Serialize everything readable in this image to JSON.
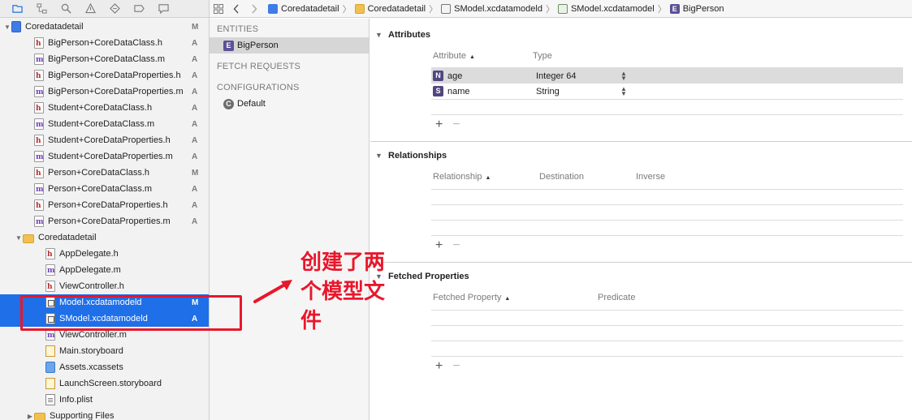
{
  "navigator": {
    "toolbar_icons": [
      "folder-icon",
      "hierarchy-icon",
      "search-icon",
      "warning-icon",
      "test-diamond-icon",
      "breakpoint-icon",
      "report-icon"
    ],
    "files": [
      {
        "name": "Coredatadetail",
        "status": "M",
        "type": "project",
        "indent": 0,
        "disclosure": "down"
      },
      {
        "name": "BigPerson+CoreDataClass.h",
        "status": "A",
        "type": "h",
        "indent": 2
      },
      {
        "name": "BigPerson+CoreDataClass.m",
        "status": "A",
        "type": "m",
        "indent": 2
      },
      {
        "name": "BigPerson+CoreDataProperties.h",
        "status": "A",
        "type": "h",
        "indent": 2
      },
      {
        "name": "BigPerson+CoreDataProperties.m",
        "status": "A",
        "type": "m",
        "indent": 2
      },
      {
        "name": "Student+CoreDataClass.h",
        "status": "A",
        "type": "h",
        "indent": 2
      },
      {
        "name": "Student+CoreDataClass.m",
        "status": "A",
        "type": "m",
        "indent": 2
      },
      {
        "name": "Student+CoreDataProperties.h",
        "status": "A",
        "type": "h",
        "indent": 2
      },
      {
        "name": "Student+CoreDataProperties.m",
        "status": "A",
        "type": "m",
        "indent": 2
      },
      {
        "name": "Person+CoreDataClass.h",
        "status": "M",
        "type": "h",
        "indent": 2
      },
      {
        "name": "Person+CoreDataClass.m",
        "status": "A",
        "type": "m",
        "indent": 2
      },
      {
        "name": "Person+CoreDataProperties.h",
        "status": "A",
        "type": "h",
        "indent": 2
      },
      {
        "name": "Person+CoreDataProperties.m",
        "status": "A",
        "type": "m",
        "indent": 2
      },
      {
        "name": "Coredatadetail",
        "status": "",
        "type": "folder",
        "indent": 1,
        "disclosure": "down"
      },
      {
        "name": "AppDelegate.h",
        "status": "",
        "type": "h",
        "indent": 3
      },
      {
        "name": "AppDelegate.m",
        "status": "",
        "type": "m",
        "indent": 3
      },
      {
        "name": "ViewController.h",
        "status": "",
        "type": "h",
        "indent": 3
      },
      {
        "name": "Model.xcdatamodeld",
        "status": "M",
        "type": "model",
        "indent": 3,
        "selected": true
      },
      {
        "name": "SModel.xcdatamodeld",
        "status": "A",
        "type": "model",
        "indent": 3,
        "selected": true
      },
      {
        "name": "ViewController.m",
        "status": "",
        "type": "m",
        "indent": 3
      },
      {
        "name": "Main.storyboard",
        "status": "",
        "type": "storyboard",
        "indent": 3
      },
      {
        "name": "Assets.xcassets",
        "status": "",
        "type": "assets",
        "indent": 3
      },
      {
        "name": "LaunchScreen.storyboard",
        "status": "",
        "type": "storyboard",
        "indent": 3
      },
      {
        "name": "Info.plist",
        "status": "",
        "type": "plist",
        "indent": 3
      },
      {
        "name": "Supporting Files",
        "status": "",
        "type": "folder",
        "indent": 2,
        "disclosure": "right"
      }
    ]
  },
  "jumpbar": {
    "crumbs": [
      {
        "label": "Coredatadetail",
        "icon": "project-icon"
      },
      {
        "label": "Coredatadetail",
        "icon": "folder-icon"
      },
      {
        "label": "SModel.xcdatamodeld",
        "icon": "model-bundle-icon"
      },
      {
        "label": "SModel.xcdatamodel",
        "icon": "model-file-icon"
      },
      {
        "label": "BigPerson",
        "icon": "entity-icon"
      }
    ]
  },
  "outline": {
    "entities_header": "ENTITIES",
    "entity": "BigPerson",
    "entity_badge": "E",
    "fetch_header": "FETCH REQUESTS",
    "config_header": "CONFIGURATIONS",
    "config": "Default",
    "config_badge": "C"
  },
  "editor": {
    "attributes": {
      "title": "Attributes",
      "col_attribute": "Attribute",
      "col_type": "Type",
      "rows": [
        {
          "badge": "N",
          "name": "age",
          "type": "Integer 64",
          "selected": true
        },
        {
          "badge": "S",
          "name": "name",
          "type": "String",
          "selected": false
        }
      ]
    },
    "relationships": {
      "title": "Relationships",
      "col_relationship": "Relationship",
      "col_destination": "Destination",
      "col_inverse": "Inverse"
    },
    "fetched": {
      "title": "Fetched Properties",
      "col_property": "Fetched Property",
      "col_predicate": "Predicate"
    },
    "add_symbol": "+",
    "remove_symbol": "−"
  },
  "annotation": {
    "text": "创建了两个模型文件",
    "color": "#e8172c"
  },
  "colors": {
    "selection": "#1e6fe8",
    "entity_badge": "#5b5196"
  }
}
